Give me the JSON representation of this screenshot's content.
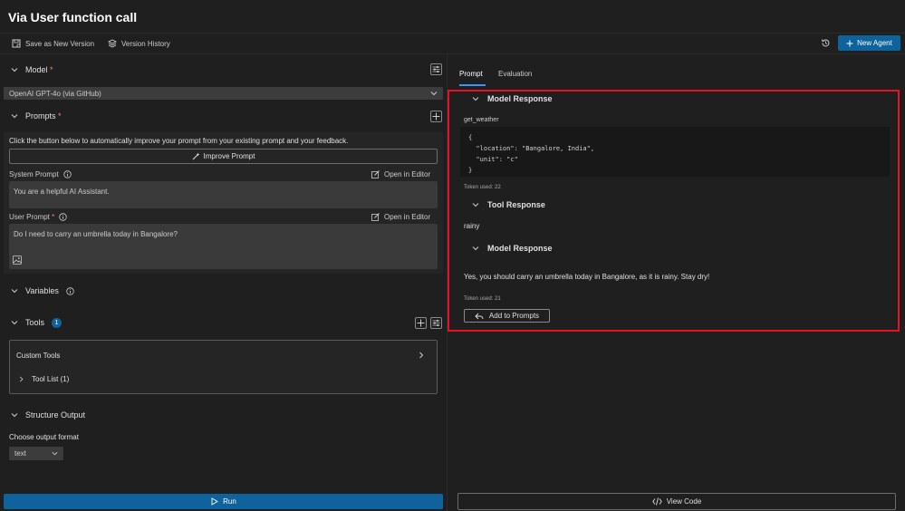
{
  "app": {
    "title": "Via User function call"
  },
  "toolbar": {
    "save_label": "Save as New Version",
    "history_label": "Version History",
    "new_agent_label": "New Agent"
  },
  "model": {
    "heading": "Model",
    "required": "*",
    "selected": "OpenAI GPT-4o (via GitHub)"
  },
  "prompts": {
    "heading": "Prompts",
    "required": "*",
    "hint": "Click the button below to automatically improve your prompt from your existing prompt and your feedback.",
    "improve_label": "Improve Prompt",
    "system_label": "System Prompt",
    "system_value": "You are a helpful AI Assistant.",
    "user_label": "User Prompt",
    "user_required": "*",
    "user_value": "Do I need to carry an umbrella today in Bangalore?",
    "open_editor": "Open in Editor"
  },
  "variables": {
    "heading": "Variables"
  },
  "tools": {
    "heading": "Tools",
    "count": "1",
    "custom_label": "Custom Tools",
    "tool_list_label": "Tool List (1)"
  },
  "structure": {
    "heading": "Structure Output",
    "choose_label": "Choose output format",
    "format_value": "text"
  },
  "run_label": "Run",
  "right": {
    "tabs": [
      {
        "label": "Prompt",
        "active": true
      },
      {
        "label": "Evaluation",
        "active": false
      }
    ],
    "response1": {
      "heading": "Model Response",
      "function_name": "get_weather",
      "code_lines": [
        "{",
        "  \"location\": \"Bangalore, India\",",
        "  \"unit\": \"c\"",
        "}"
      ],
      "tokens": "Token used: 22"
    },
    "tool_response": {
      "heading": "Tool Response",
      "value": "rainy"
    },
    "response2": {
      "heading": "Model Response",
      "text": "Yes, you should carry an umbrella today in Bangalore, as it is rainy. Stay dry!",
      "tokens": "Token used: 21"
    },
    "add_label": "Add to Prompts",
    "view_code_label": "View Code"
  },
  "colors": {
    "accent": "#0e639c",
    "highlight": "#e81123",
    "tab_underline": "#3794ff"
  }
}
